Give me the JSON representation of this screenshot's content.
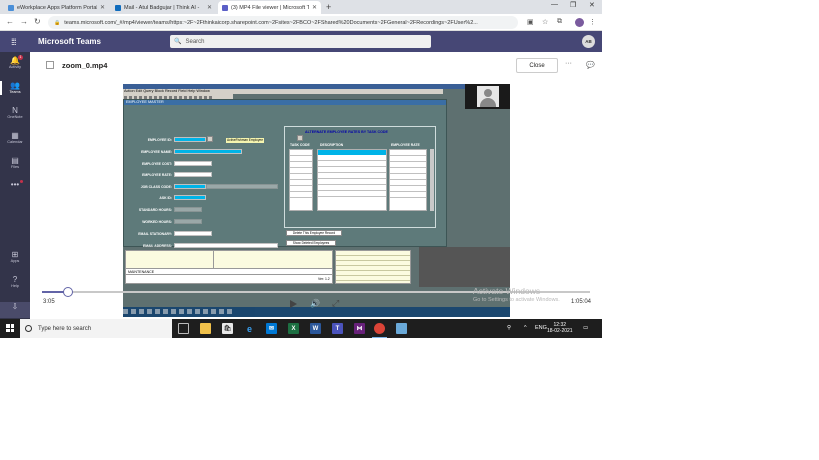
{
  "browser": {
    "tabs": [
      {
        "title": "eWorkplace Apps Platform Portal",
        "color": "#4a8fd8",
        "active": false
      },
      {
        "title": "Mail - Atul Badgujar | Think AI -",
        "color": "#0f6cbd",
        "active": false
      },
      {
        "title": "(3) MP4 File viewer | Microsoft Te",
        "color": "#5b5fc7",
        "active": true
      }
    ],
    "new_tab": "+",
    "url": "teams.microsoft.com/_#/mp4/viewer/teams/https:~2F~2Fthinkaicorp.sharepoint.com~2Fsites~2FBCO~2FShared%20Documents~2FGeneral~2FRecordings~2FUser%2..."
  },
  "teams": {
    "app_name": "Microsoft Teams",
    "search_placeholder": "Search",
    "avatar_initials": "AB",
    "rail": [
      {
        "label": "Activity",
        "icon": "bell-icon",
        "glyph": "🔔",
        "badge": "1"
      },
      {
        "label": "Teams",
        "icon": "teams-icon",
        "glyph": "👥",
        "active": true
      },
      {
        "label": "OneNote",
        "icon": "onenote-icon",
        "glyph": "N"
      },
      {
        "label": "Calendar",
        "icon": "calendar-icon",
        "glyph": "▦"
      },
      {
        "label": "Files",
        "icon": "files-icon",
        "glyph": "▤"
      },
      {
        "label": "Apps",
        "icon": "apps-icon",
        "glyph": "⊞"
      },
      {
        "label": "Help",
        "icon": "help-icon",
        "glyph": "?"
      }
    ],
    "more_glyph": "•••"
  },
  "viewer": {
    "filename": "zoom_0.mp4",
    "close_label": "Close",
    "more_glyph": "···",
    "current_time": "3:05",
    "total_time": "1:05:04",
    "progress_fraction": 0.047
  },
  "recording": {
    "menubar": "Action  Edit  Query  Block  Record  Field  Help  Window",
    "window_title": "EMPLOYEE MASTER",
    "fields": [
      "EMPLOYEE ID:",
      "EMPLOYEE NAME:",
      "EMPLOYEE COST:",
      "EMPLOYEE RATE:",
      "JOB CLASS CODE:",
      "ASK ID:",
      "STANDARD HOURS:",
      "WORKED HOURS:",
      "EMAIL STATIONARY:",
      "EMAIL ADDRESS:"
    ],
    "active_tag": "ActiveFishman Employee",
    "alt_title": "ALTERNATE EMPLOYEE RATES BY TASK CODE",
    "col_task": "TASK CODE",
    "col_desc": "DESCRIPTION",
    "col_rate": "EMPLOYEE RATE",
    "delete_btn": "Delete This Employee Record",
    "show_btn": "Show Deleted Employees",
    "pager": "< 4.0",
    "maintenance": "MAINTENANCE",
    "version": "Ver: 1.2"
  },
  "watermark": {
    "line1": "Activate Windows",
    "line2": "Go to Settings to activate Windows."
  },
  "taskbar": {
    "search_placeholder": "Type here to search",
    "lang": "ENG",
    "time": "12:32",
    "date": "18-02-2021"
  }
}
